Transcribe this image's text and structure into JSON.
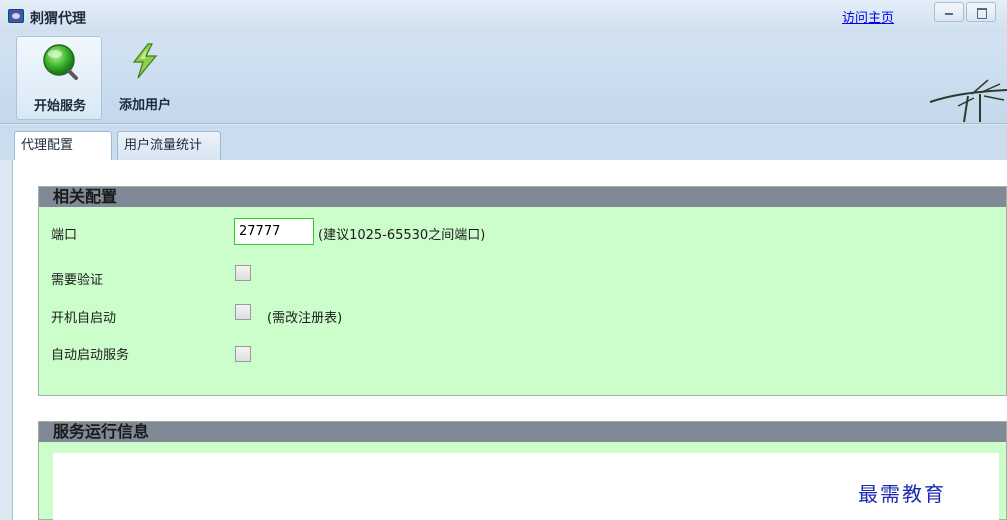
{
  "window": {
    "title": "刺猬代理",
    "visit_link": "访问主页"
  },
  "toolbar": {
    "start_service_label": "开始服务",
    "add_user_label": "添加用户"
  },
  "tabs": [
    {
      "label": "代理配置",
      "active": true
    },
    {
      "label": "用户流量统计",
      "active": false
    }
  ],
  "config": {
    "header": "相关配置",
    "port_label": "端口",
    "port_value": "27777",
    "port_hint": "(建议1025-65530之间端口)",
    "auth_label": "需要验证",
    "auth_checked": false,
    "autostart_label": "开机自启动",
    "autostart_checked": false,
    "autostart_hint": "(需改注册表)",
    "autoservice_label": "自动启动服务",
    "autoservice_checked": false
  },
  "service_info": {
    "header": "服务运行信息"
  },
  "watermark": "最需教育",
  "colors": {
    "panel_bg": "#ccfecc",
    "header_bg": "#7f8a96",
    "link": "#0000ee",
    "watermark": "#1a2bb0"
  }
}
